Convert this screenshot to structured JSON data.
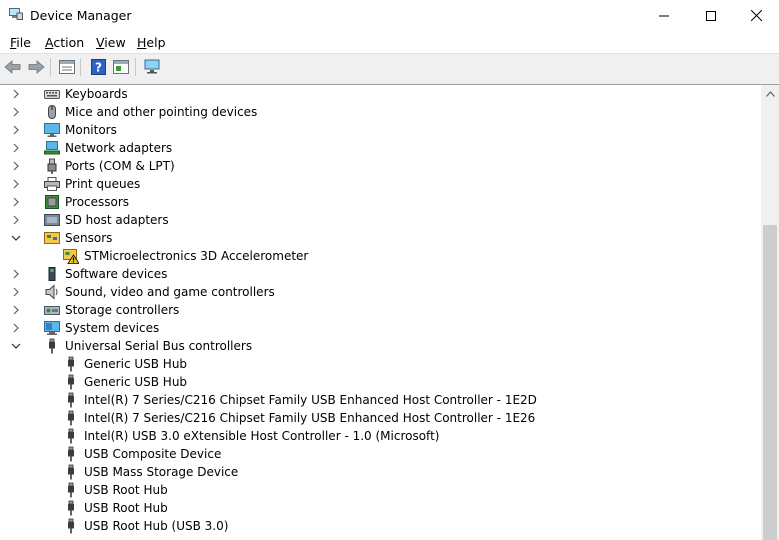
{
  "window": {
    "title": "Device Manager",
    "minimize_icon": "minimize-icon",
    "maximize_icon": "maximize-icon",
    "close_icon": "close-icon"
  },
  "menu": [
    {
      "label": "File",
      "accel": "F",
      "rest": "ile"
    },
    {
      "label": "Action",
      "accel": "A",
      "rest": "ction"
    },
    {
      "label": "View",
      "accel": "V",
      "rest": "iew"
    },
    {
      "label": "Help",
      "accel": "H",
      "rest": "elp"
    }
  ],
  "toolbar": [
    "back-arrow-icon",
    "forward-arrow-icon",
    "properties-icon",
    "help-icon",
    "update-driver-icon",
    "scan-hardware-icon"
  ],
  "tree": [
    {
      "label": "Keyboards",
      "level": 0,
      "state": "collapsed",
      "icon": "keyboard-icon"
    },
    {
      "label": "Mice and other pointing devices",
      "level": 0,
      "state": "collapsed",
      "icon": "mouse-icon"
    },
    {
      "label": "Monitors",
      "level": 0,
      "state": "collapsed",
      "icon": "monitor-icon"
    },
    {
      "label": "Network adapters",
      "level": 0,
      "state": "collapsed",
      "icon": "network-adapter-icon"
    },
    {
      "label": "Ports (COM & LPT)",
      "level": 0,
      "state": "collapsed",
      "icon": "port-icon"
    },
    {
      "label": "Print queues",
      "level": 0,
      "state": "collapsed",
      "icon": "printer-icon"
    },
    {
      "label": "Processors",
      "level": 0,
      "state": "collapsed",
      "icon": "processor-icon"
    },
    {
      "label": "SD host adapters",
      "level": 0,
      "state": "collapsed",
      "icon": "sd-card-icon"
    },
    {
      "label": "Sensors",
      "level": 0,
      "state": "expanded",
      "icon": "sensor-icon"
    },
    {
      "label": "STMicroelectronics 3D Accelerometer",
      "level": 1,
      "state": "leaf",
      "icon": "sensor-warning-icon"
    },
    {
      "label": "Software devices",
      "level": 0,
      "state": "collapsed",
      "icon": "software-device-icon"
    },
    {
      "label": "Sound, video and game controllers",
      "level": 0,
      "state": "collapsed",
      "icon": "speaker-icon"
    },
    {
      "label": "Storage controllers",
      "level": 0,
      "state": "collapsed",
      "icon": "storage-controller-icon"
    },
    {
      "label": "System devices",
      "level": 0,
      "state": "collapsed",
      "icon": "system-device-icon"
    },
    {
      "label": "Universal Serial Bus controllers",
      "level": 0,
      "state": "expanded",
      "icon": "usb-icon"
    },
    {
      "label": "Generic USB Hub",
      "level": 1,
      "state": "leaf",
      "icon": "usb-icon"
    },
    {
      "label": "Generic USB Hub",
      "level": 1,
      "state": "leaf",
      "icon": "usb-icon"
    },
    {
      "label": "Intel(R) 7 Series/C216 Chipset Family USB Enhanced Host Controller - 1E2D",
      "level": 1,
      "state": "leaf",
      "icon": "usb-icon"
    },
    {
      "label": "Intel(R) 7 Series/C216 Chipset Family USB Enhanced Host Controller - 1E26",
      "level": 1,
      "state": "leaf",
      "icon": "usb-icon"
    },
    {
      "label": "Intel(R) USB 3.0 eXtensible Host Controller - 1.0 (Microsoft)",
      "level": 1,
      "state": "leaf",
      "icon": "usb-icon"
    },
    {
      "label": "USB Composite Device",
      "level": 1,
      "state": "leaf",
      "icon": "usb-icon"
    },
    {
      "label": "USB Mass Storage Device",
      "level": 1,
      "state": "leaf",
      "icon": "usb-icon"
    },
    {
      "label": "USB Root Hub",
      "level": 1,
      "state": "leaf",
      "icon": "usb-icon"
    },
    {
      "label": "USB Root Hub",
      "level": 1,
      "state": "leaf",
      "icon": "usb-icon"
    },
    {
      "label": "USB Root Hub (USB 3.0)",
      "level": 1,
      "state": "leaf",
      "icon": "usb-icon"
    }
  ]
}
